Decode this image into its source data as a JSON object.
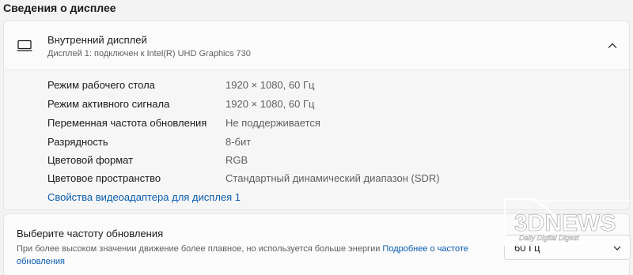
{
  "section": {
    "title": "Сведения о дисплее"
  },
  "display_card": {
    "title": "Внутренний дисплей",
    "subtitle": "Дисплей 1: подключен к Intel(R) UHD Graphics 730",
    "properties": [
      {
        "label": "Режим рабочего стола",
        "value": "1920 × 1080, 60 Гц"
      },
      {
        "label": "Режим активного сигнала",
        "value": "1920 × 1080, 60 Гц"
      },
      {
        "label": "Переменная частота обновления",
        "value": "Не поддерживается"
      },
      {
        "label": "Разрядность",
        "value": "8-бит"
      },
      {
        "label": "Цветовой формат",
        "value": "RGB"
      },
      {
        "label": "Цветовое пространство",
        "value": "Стандартный динамический диапазон (SDR)"
      }
    ],
    "adapter_link": "Свойства видеоадаптера для дисплея 1"
  },
  "refresh_card": {
    "title": "Выберите частоту обновления",
    "description": "При более высоком значении движение более плавное, но используется больше энергии",
    "learn_more": "Подробнее о частоте обновления",
    "selected_rate": "60 Гц"
  },
  "watermark": {
    "logo": "3DNEWS",
    "tagline": "Daily Digital Digest"
  },
  "colors": {
    "accent_link": "#0a5cad",
    "background": "#f3f3f3",
    "card": "#fbfbfb"
  }
}
